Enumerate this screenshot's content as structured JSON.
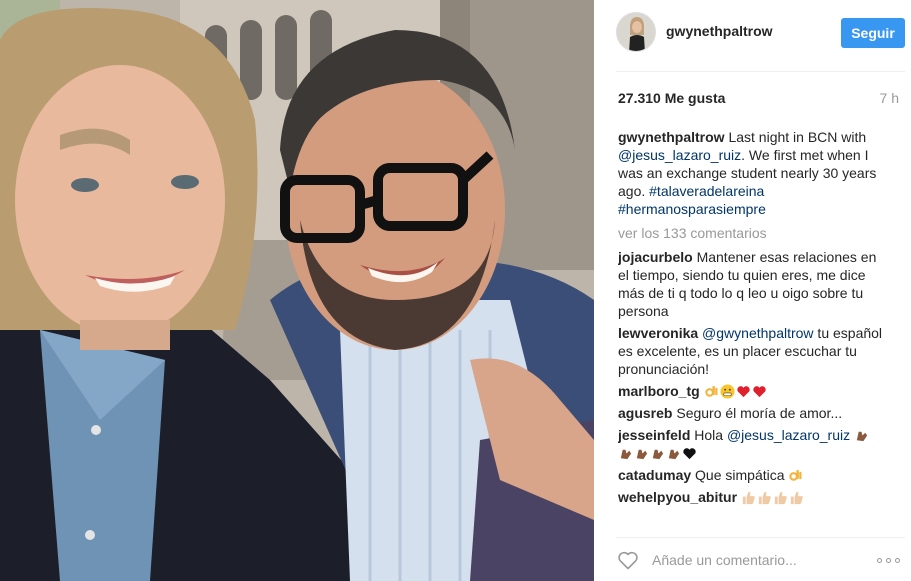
{
  "post": {
    "username": "gwynethpaltrow",
    "follow_label": "Seguir",
    "likes": "27.310 Me gusta",
    "time": "7 h"
  },
  "caption": {
    "username": "gwynethpaltrow",
    "text_1": " Last night in BCN with ",
    "mention": "@jesus_lazaro_ruiz",
    "text_2": ". We first met when I was an exchange student nearly 30 years ago. ",
    "hashtag_1": "#talaveradelareina",
    "hashtag_2": "#hermanosparasiempre"
  },
  "view_all": "ver los 133 comentarios",
  "comments": [
    {
      "user": "jojacurbelo",
      "text": " Mantener esas relaciones en el tiempo, siendo tu quien eres, me dice más de ti q todo lo q leo u oigo sobre tu persona"
    },
    {
      "user": "lewveronika",
      "mention": "@gwynethpaltrow",
      "text": " tu español es excelente, es un placer escuchar tu pronunciación!"
    },
    {
      "user": "marlboro_tg",
      "emojis": [
        "ok-hand",
        "grimace-face",
        "red-heart",
        "red-heart"
      ]
    },
    {
      "user": "agusreb",
      "text": " Seguro él moría de amor..."
    },
    {
      "user": "jesseinfeld",
      "text": " Hola ",
      "mention": "@jesus_lazaro_ruiz",
      "emojis": [
        "clap",
        "clap",
        "clap",
        "clap",
        "clap",
        "black-heart"
      ]
    },
    {
      "user": "catadumay",
      "text": " Que simpática ",
      "emojis": [
        "ok-hand"
      ]
    },
    {
      "user": "wehelpyou_abitur",
      "emojis": [
        "thumbs-up",
        "thumbs-up",
        "thumbs-up",
        "thumbs-up"
      ]
    }
  ],
  "comment_input": {
    "placeholder": "Añade un comentario..."
  },
  "icons": {
    "like": "heart-outline-icon",
    "more": "more-options-icon"
  },
  "colors": {
    "accent": "#3897f0",
    "link": "#003569",
    "muted": "#999999"
  }
}
